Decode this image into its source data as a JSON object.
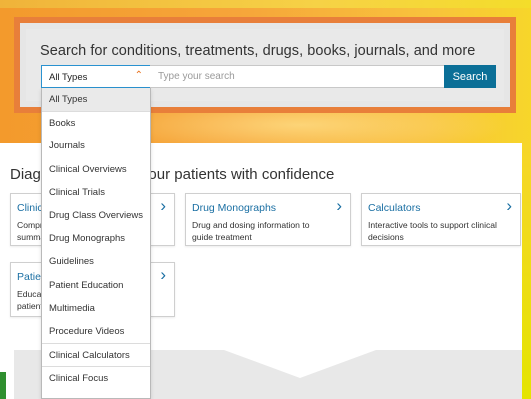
{
  "search": {
    "title": "Search for conditions, treatments, drugs, books, journals, and more",
    "type_selected": "All Types",
    "placeholder": "Type your search",
    "button": "Search",
    "type_options": [
      "All Types",
      "Books",
      "Journals",
      "Clinical Overviews",
      "Clinical Trials",
      "Drug Class Overviews",
      "Drug Monographs",
      "Guidelines",
      "Patient Education",
      "Multimedia",
      "Procedure Videos",
      "Clinical Calculators",
      "Clinical Focus"
    ]
  },
  "section": {
    "title": "Diagnose and treat your patients with confidence",
    "cards": [
      {
        "title": "Clinical Overviews",
        "desc_line1": "Comprehensive, evidence-based",
        "desc_line2": "summaries"
      },
      {
        "title": "Drug Monographs",
        "desc_line1": "Drug and dosing information to",
        "desc_line2": "guide treatment"
      },
      {
        "title": "Calculators",
        "desc_line1": "Interactive tools to support clinical",
        "desc_line2": "decisions"
      },
      {
        "title": "Patient Education",
        "desc_line1": "Educational materials for your",
        "desc_line2": "patients"
      }
    ]
  },
  "colors": {
    "accent_orange": "#e87f3a",
    "link_blue": "#1a6fa3",
    "button_blue": "#0b6f97"
  },
  "icons": {
    "select_chevron": "chevron-up-icon",
    "card_chevron": "chevron-right-icon"
  }
}
